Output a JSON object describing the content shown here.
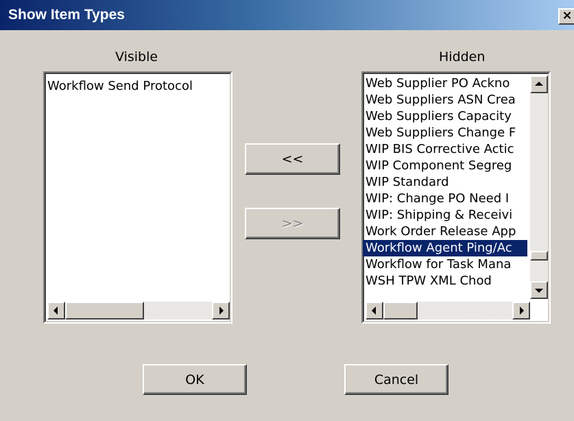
{
  "dialog": {
    "title": "Show Item Types",
    "close_label": "×"
  },
  "visible": {
    "label": "Visible",
    "items": [
      "Workflow Send Protocol"
    ]
  },
  "hidden": {
    "label": "Hidden",
    "items": [
      "Web Supplier PO Ackno",
      "Web Suppliers ASN Crea",
      "Web Suppliers Capacity",
      "Web Suppliers Change F",
      "WIP BIS Corrective Actic",
      "WIP Component Segreg",
      "WIP Standard",
      "WIP: Change PO Need I",
      "WIP: Shipping & Receivi",
      "Work Order Release App",
      "Workflow Agent Ping/Ac",
      "Workflow for Task Mana",
      "WSH TPW XML Chod"
    ],
    "selected_item": "Workflow Agent Ping/Ac"
  },
  "buttons": {
    "move_to_visible": "<<",
    "move_to_hidden": ">>",
    "ok": "OK",
    "cancel": "Cancel"
  },
  "colors": {
    "selection_bg": "#0a246a",
    "face": "#d4d0c8"
  }
}
